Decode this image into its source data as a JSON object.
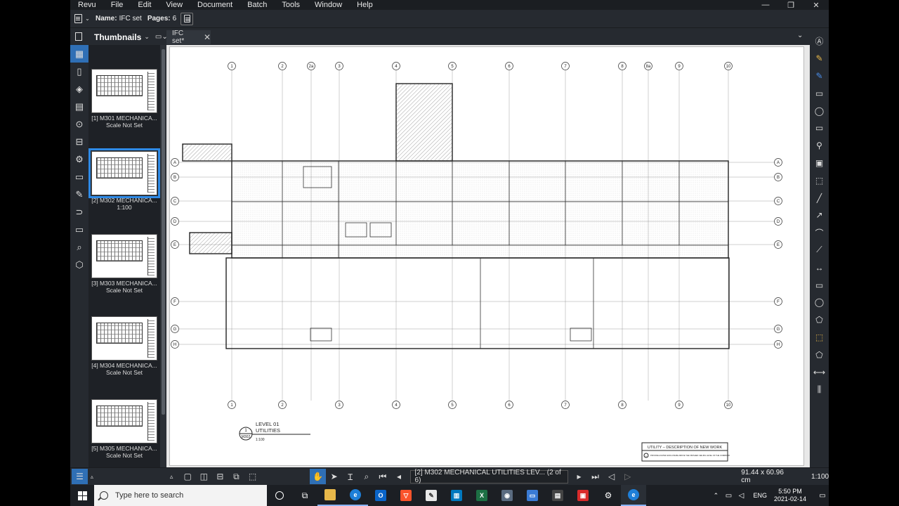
{
  "menu": [
    "Revu",
    "File",
    "Edit",
    "View",
    "Document",
    "Batch",
    "Tools",
    "Window",
    "Help"
  ],
  "window_controls": [
    "—",
    "❐",
    "✕"
  ],
  "toolbar": {
    "name_label": "Name:",
    "name_value": "IFC set",
    "pages_label": "Pages:",
    "pages_value": "6"
  },
  "panel": {
    "title": "Thumbnails"
  },
  "tab": {
    "label": "IFC set*",
    "close": "✕"
  },
  "thumbnails": [
    {
      "line1": "[1] M301 MECHANICA...",
      "line2": "Scale Not Set"
    },
    {
      "line1": "[2] M302 MECHANICA...",
      "line2": "1:100"
    },
    {
      "line1": "[3] M303 MECHANICA...",
      "line2": "Scale Not Set"
    },
    {
      "line1": "[4] M304 MECHANICA...",
      "line2": "Scale Not Set"
    },
    {
      "line1": "[5] M305 MECHANICA...",
      "line2": "Scale Not Set"
    }
  ],
  "drawing": {
    "grid_top": [
      "1",
      "2",
      "2a",
      "3",
      "4",
      "5",
      "6",
      "7",
      "8",
      "8a",
      "9",
      "10"
    ],
    "grid_bottom": [
      "1",
      "2",
      "3",
      "4",
      "5",
      "6",
      "7",
      "8",
      "9",
      "10"
    ],
    "grid_rows": [
      "A",
      "B",
      "C",
      "D",
      "E",
      "F",
      "G",
      "H"
    ],
    "title_num": "1",
    "title_sheet": "M302",
    "title_line1": "LEVEL 01",
    "title_line2": "UTILITIES",
    "title_scale": "1:100",
    "legend_title": "UTILITY – DESCRIPTION OF NEW WORK",
    "legend_item": "PROVIDE A RATED ENCLOSURE ABOVE THE FINISHED CEILING LEVEL OF THE CORRIDOR",
    "legend_num": "1"
  },
  "status": {
    "page_label": "[2] M302 MECHANICAL UTILITIES LEV... (2 of 6)",
    "dimensions": "91.44 x 60.96 cm",
    "scale": "1:100"
  },
  "taskbar": {
    "search_placeholder": "Type here to search",
    "lang": "ENG",
    "time": "5:50 PM",
    "date": "2021-02-14"
  }
}
